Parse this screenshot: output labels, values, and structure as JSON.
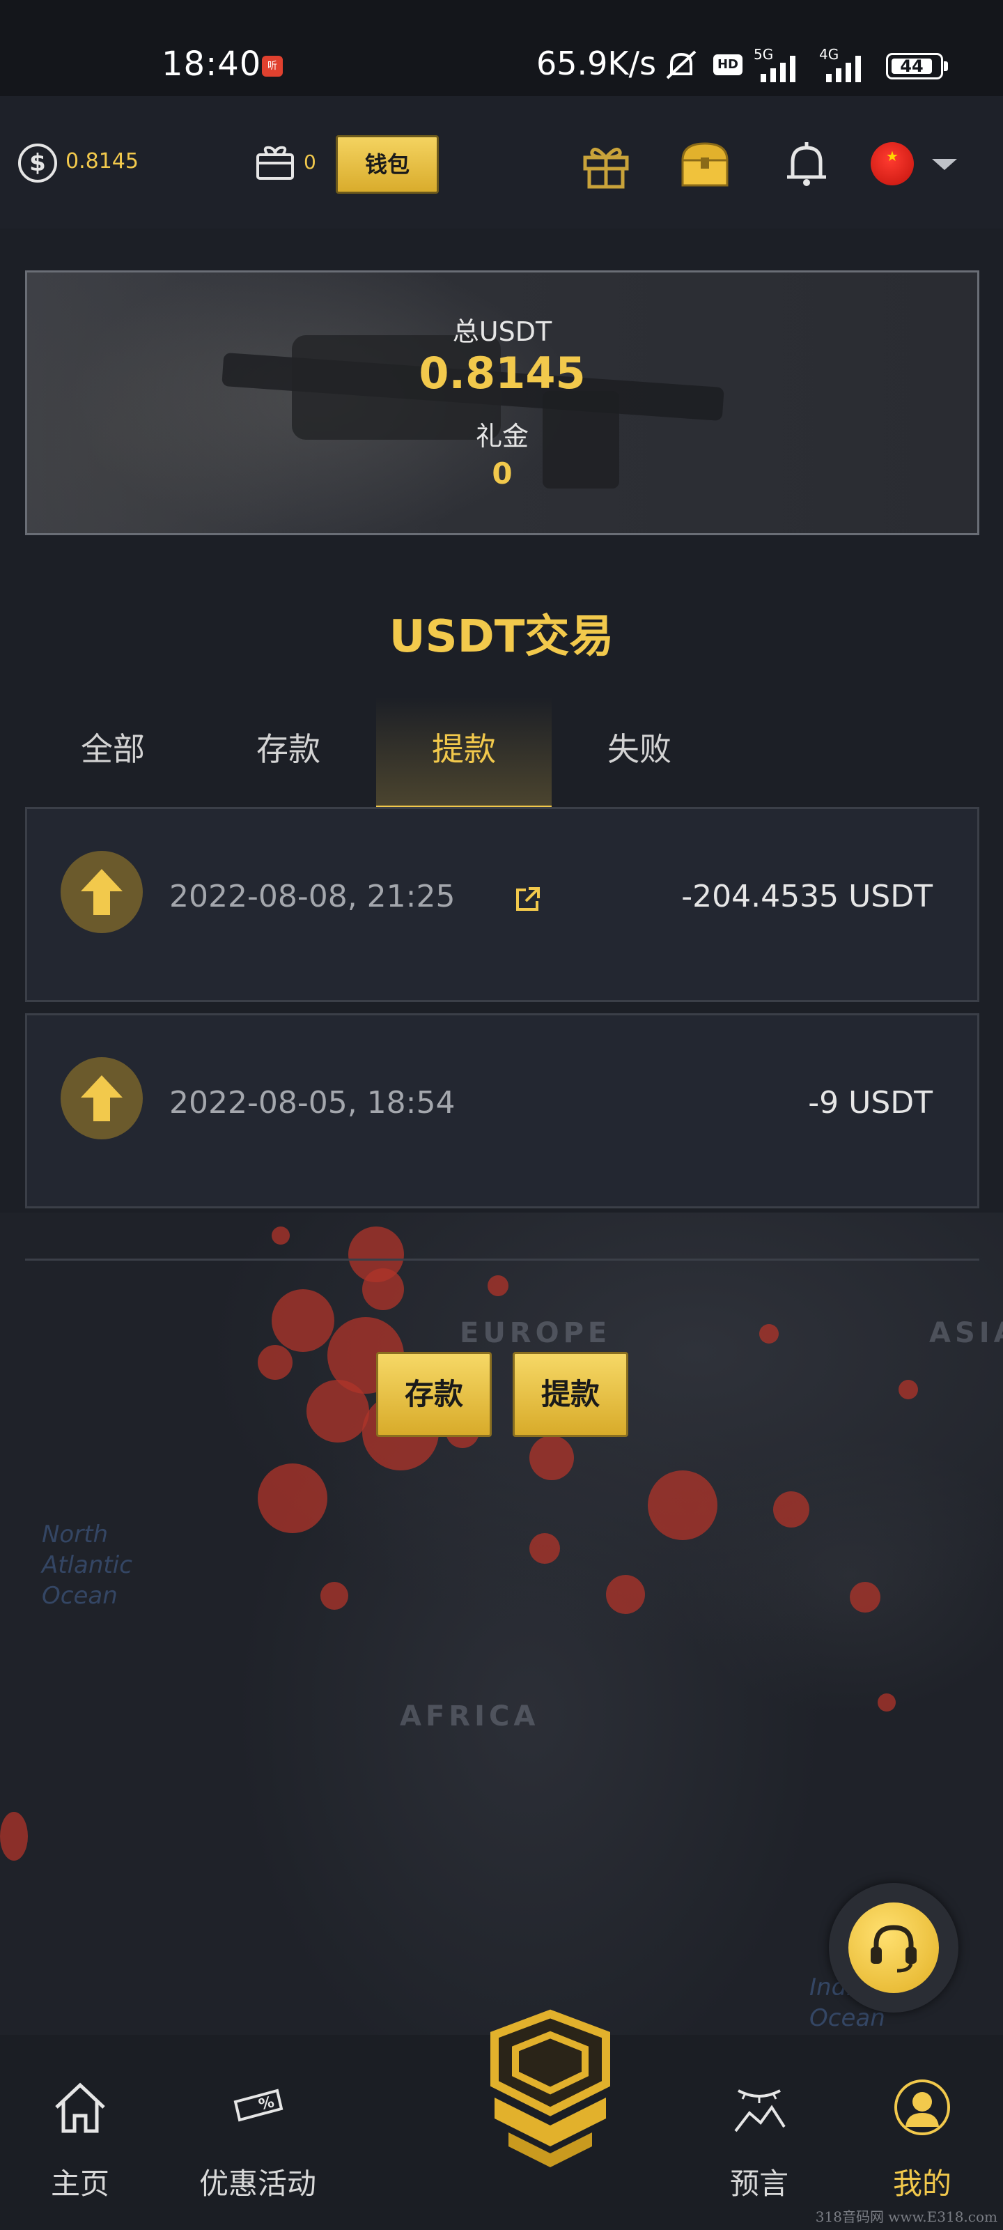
{
  "status_bar": {
    "time": "18:40",
    "app_badge": "听",
    "net_speed": "65.9K/s",
    "hd_badge": "HD",
    "signal1_label": "5G",
    "signal2_label": "4G",
    "battery": "44"
  },
  "header": {
    "balance": "0.8145",
    "ticket_count": "0",
    "wallet_label": "钱包"
  },
  "balance_card": {
    "total_label": "总USDT",
    "total_value": "0.8145",
    "gift_label": "礼金",
    "gift_value": "0"
  },
  "section_title": "USDT交易",
  "tabs": [
    {
      "label": "全部",
      "active": false
    },
    {
      "label": "存款",
      "active": false
    },
    {
      "label": "提款",
      "active": true
    },
    {
      "label": "失败",
      "active": false
    }
  ],
  "transactions": [
    {
      "date": "2022-08-08, 21:25",
      "amount": "-204.4535 USDT",
      "has_link": true
    },
    {
      "date": "2022-08-05, 18:54",
      "amount": "-9 USDT",
      "has_link": false
    }
  ],
  "map_labels": {
    "europe": "EUROPE",
    "africa": "AFRICA",
    "asia": "ASIA",
    "north_atlantic": "North Atlantic Ocean",
    "indian_ocean": "Indian Ocean"
  },
  "actions": {
    "deposit_label": "存款",
    "withdraw_label": "提款"
  },
  "bottom_nav": [
    {
      "label": "主页",
      "icon": "home-icon",
      "active": false
    },
    {
      "label": "优惠活动",
      "icon": "ticket-percent-icon",
      "active": false
    },
    {
      "label": "预言",
      "icon": "prediction-chart-icon",
      "active": false
    },
    {
      "label": "我的",
      "icon": "user-icon",
      "active": true
    }
  ],
  "watermark": "318音码网 www.E318.com",
  "colors": {
    "accent": "#f2c94c",
    "background": "#1c1f26",
    "card": "#232731"
  }
}
